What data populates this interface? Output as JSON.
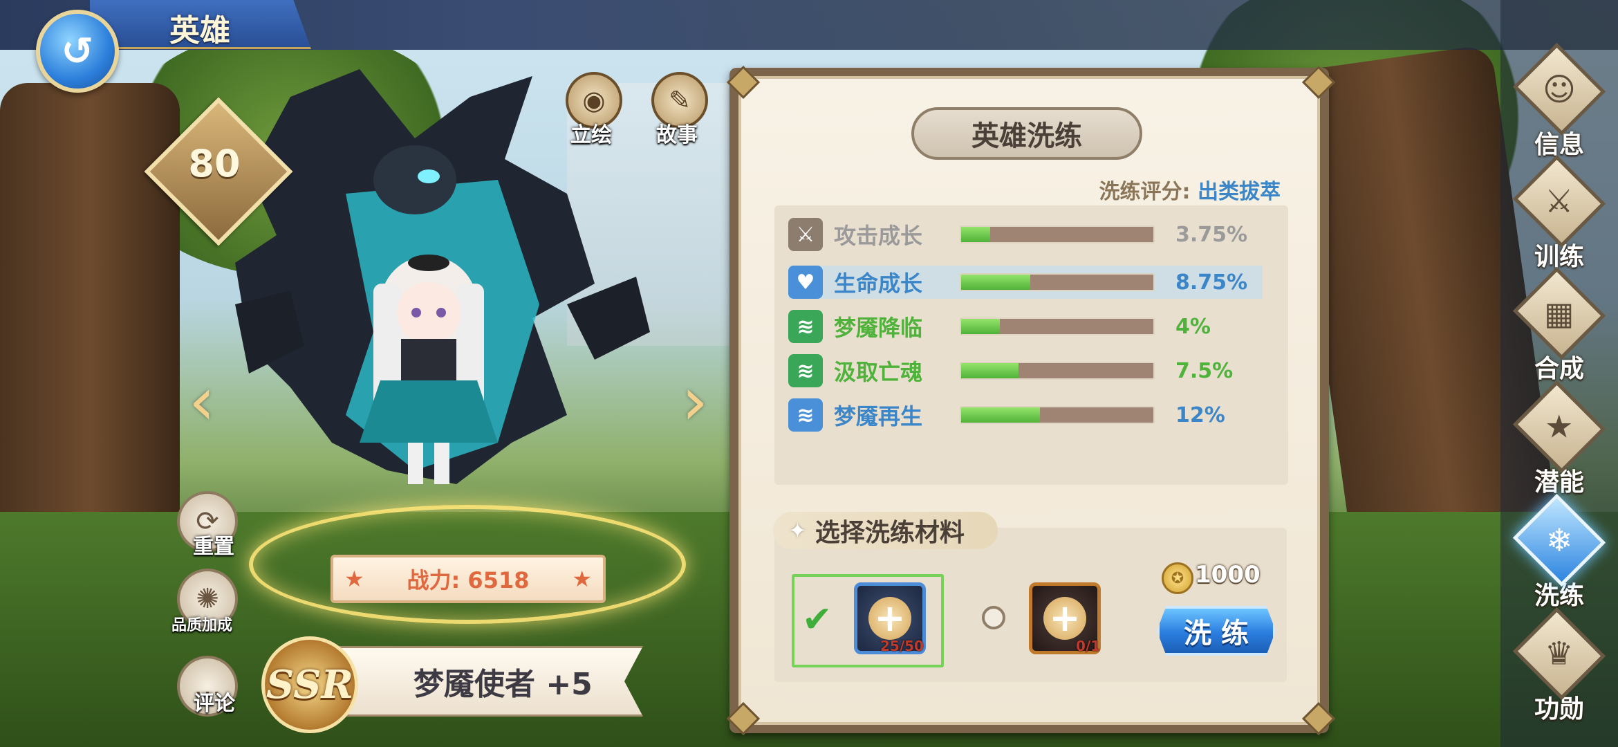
{
  "header": {
    "title": "英雄",
    "back_icon": "return-arrow-icon"
  },
  "hero": {
    "level": "80",
    "name": "梦魇使者 +5",
    "rarity": "SSR",
    "power_label": "战力: 6518",
    "buttons": {
      "portrait": "立绘",
      "story": "故事",
      "reset": "重置",
      "quality_bonus": "品质加成",
      "comment": "评论"
    }
  },
  "panel": {
    "title": "英雄洗练",
    "rating_label": "洗练评分:",
    "rating_value": "出类拔萃",
    "stats": [
      {
        "label": "攻击成长",
        "value": "3.75%",
        "fill": 0.15,
        "icon": "sword-icon",
        "color": "#9a9a9a",
        "icon_bg": "#8c7d6e"
      },
      {
        "label": "生命成长",
        "value": "8.75%",
        "fill": 0.36,
        "icon": "heart-icon",
        "color": "#3a86c9",
        "icon_bg": "#4a90d8"
      },
      {
        "label": "梦魇降临",
        "value": "4%",
        "fill": 0.2,
        "icon": "claw-icon",
        "color": "#4fb23a",
        "icon_bg": "#3aa758"
      },
      {
        "label": "汲取亡魂",
        "value": "7.5%",
        "fill": 0.3,
        "icon": "claw-icon",
        "color": "#4fb23a",
        "icon_bg": "#3aa758"
      },
      {
        "label": "梦魇再生",
        "value": "12%",
        "fill": 0.41,
        "icon": "claw-icon",
        "color": "#3a86c9",
        "icon_bg": "#4a90d8"
      }
    ],
    "materials_title": "选择洗练材料",
    "materials": [
      {
        "count": "25/50",
        "selected": true
      },
      {
        "count": "0/1",
        "selected": false
      }
    ],
    "cost": "1000",
    "refine_button": "洗 练"
  },
  "nav": [
    {
      "label": "信息",
      "icon": "info-face-icon",
      "active": false
    },
    {
      "label": "训练",
      "icon": "training-icon",
      "active": false
    },
    {
      "label": "合成",
      "icon": "cards-icon",
      "active": false
    },
    {
      "label": "潜能",
      "icon": "potential-star-icon",
      "active": false
    },
    {
      "label": "洗练",
      "icon": "refine-icon",
      "active": true
    },
    {
      "label": "功勋",
      "icon": "crown-icon",
      "active": false
    }
  ]
}
